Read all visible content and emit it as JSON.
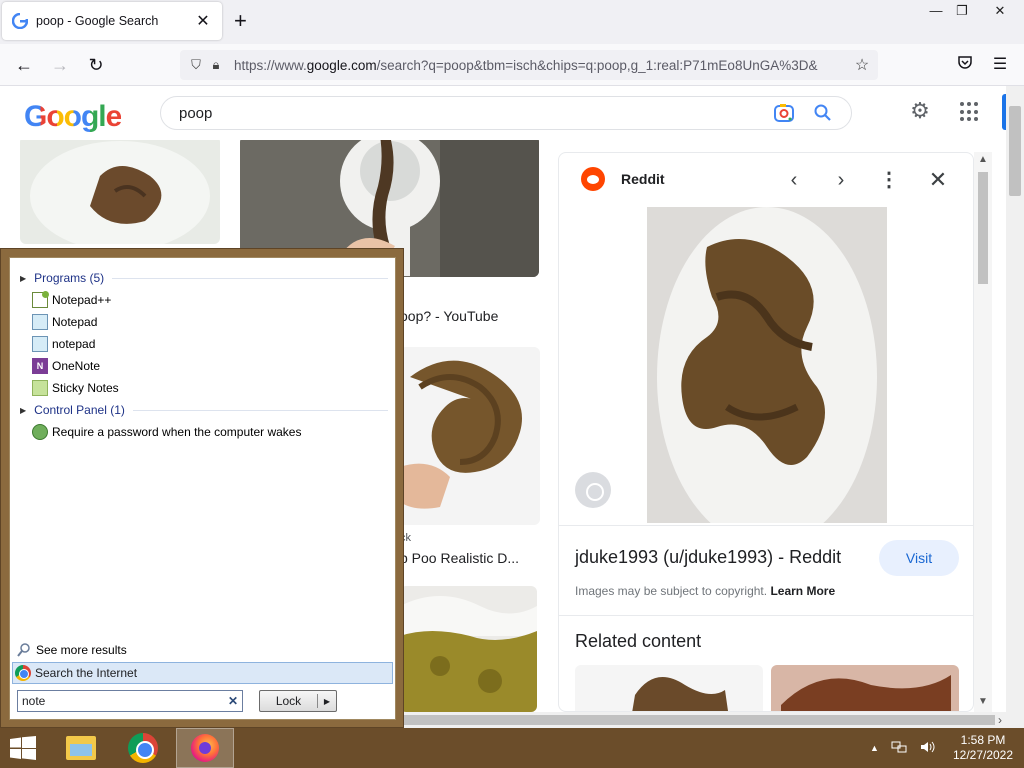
{
  "browser": {
    "tab_title": "poop - Google Search",
    "tab_close": "✕",
    "new_tab": "+",
    "window_controls": {
      "minimize": "—",
      "maximize": "❐",
      "close": "✕"
    },
    "url_prefix": "https://www.",
    "url_domain": "google.com",
    "url_rest": "/search?q=poop&tbm=isch&chips=q:poop,g_1:real:P71mEo8UnGA%3D&"
  },
  "google": {
    "logo": "Google",
    "search_query": "poop",
    "colors": {
      "blue": "#4285f4",
      "red": "#ea4335",
      "yellow": "#fbbc05",
      "green": "#34a853"
    }
  },
  "results": {
    "items": [
      {
        "title": "oop? - YouTube",
        "source": ""
      },
      {
        "title": "p Poo Realistic D...",
        "source": "ck"
      }
    ]
  },
  "panel": {
    "source": "Reddit",
    "title": "jduke1993 (u/jduke1993) - Reddit",
    "visit": "Visit",
    "copyright": "Images may be subject to copyright.",
    "learn_more": "Learn More",
    "related": "Related content"
  },
  "start_menu": {
    "programs_header": "Programs (5)",
    "programs": [
      "Notepad++",
      "Notepad",
      "notepad",
      "OneNote",
      "Sticky Notes"
    ],
    "control_panel_header": "Control Panel (1)",
    "control_panel_items": [
      "Require a password when the computer wakes"
    ],
    "see_more": "See more results",
    "search_internet": "Search the Internet",
    "search_value": "note",
    "clear": "✕",
    "lock": "Lock"
  },
  "taskbar": {
    "time": "1:58 PM",
    "date": "12/27/2022"
  }
}
